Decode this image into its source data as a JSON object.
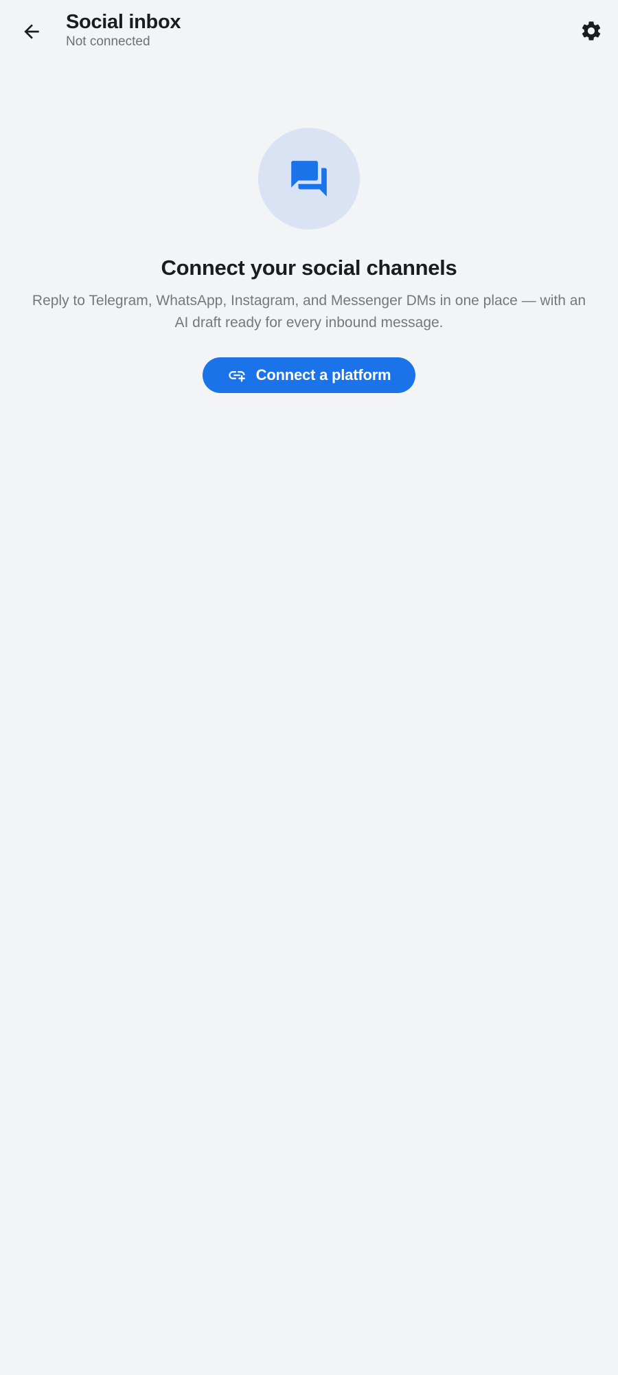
{
  "header": {
    "title": "Social inbox",
    "subtitle": "Not connected",
    "back_icon": "arrow-back-icon",
    "settings_icon": "gear-icon"
  },
  "empty_state": {
    "illustration_icon": "forum-chat-icon",
    "heading": "Connect your social channels",
    "description": "Reply to Telegram, WhatsApp, Instagram, and Messenger DMs in one place — with an AI draft ready for every inbound message.",
    "cta": {
      "label": "Connect a platform",
      "icon": "add-link-icon"
    }
  },
  "colors": {
    "background": "#f3f4f6",
    "accent": "#1a73e8",
    "icon_circle": "#dae3f3",
    "text_primary": "#1b1c1f",
    "text_secondary": "#75777c"
  }
}
